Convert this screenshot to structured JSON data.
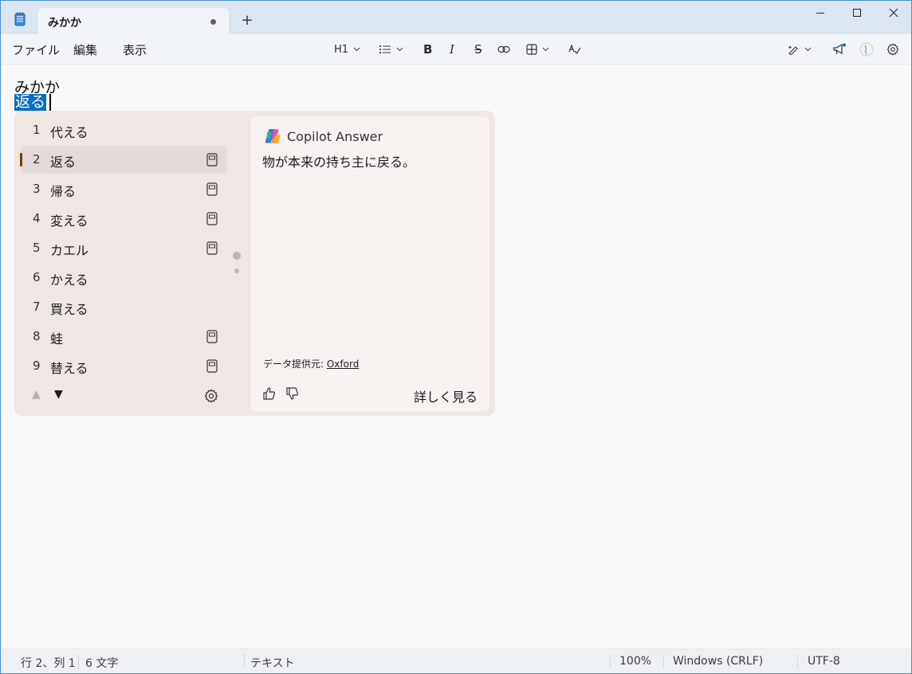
{
  "window": {
    "tab_title": "みかか",
    "new_tab_label": "+",
    "minimize_label": "—",
    "maximize_label": "☐",
    "close_label": "✕"
  },
  "menu": {
    "file": "ファイル",
    "edit": "編集",
    "view": "表示"
  },
  "toolbar": {
    "heading_label": "H1",
    "bold_label": "B",
    "italic_label": "I",
    "strike_label": "S"
  },
  "document": {
    "line1": "みかか",
    "line2": "返る"
  },
  "ime": {
    "selected_index": 2,
    "candidates": [
      {
        "num": "1",
        "text": "代える",
        "has_dictionary_icon": false
      },
      {
        "num": "2",
        "text": "返る",
        "has_dictionary_icon": true
      },
      {
        "num": "3",
        "text": "帰る",
        "has_dictionary_icon": true
      },
      {
        "num": "4",
        "text": "変える",
        "has_dictionary_icon": true
      },
      {
        "num": "5",
        "text": "カエル",
        "has_dictionary_icon": true
      },
      {
        "num": "6",
        "text": "かえる",
        "has_dictionary_icon": false
      },
      {
        "num": "7",
        "text": "買える",
        "has_dictionary_icon": false
      },
      {
        "num": "8",
        "text": "蛙",
        "has_dictionary_icon": true
      },
      {
        "num": "9",
        "text": "替える",
        "has_dictionary_icon": true
      }
    ],
    "prev_page_label": "▲",
    "next_page_label": "▼"
  },
  "copilot": {
    "title": "Copilot Answer",
    "answer": "物が本来の持ち主に戻る。",
    "source_prefix": "データ提供元: ",
    "source_name": "Oxford",
    "more_label": "詳しく見る"
  },
  "status": {
    "position": "行 2、列 1",
    "char_count": "6 文字",
    "format": "テキスト",
    "zoom": "100%",
    "line_ending": "Windows (CRLF)",
    "encoding": "UTF-8"
  }
}
